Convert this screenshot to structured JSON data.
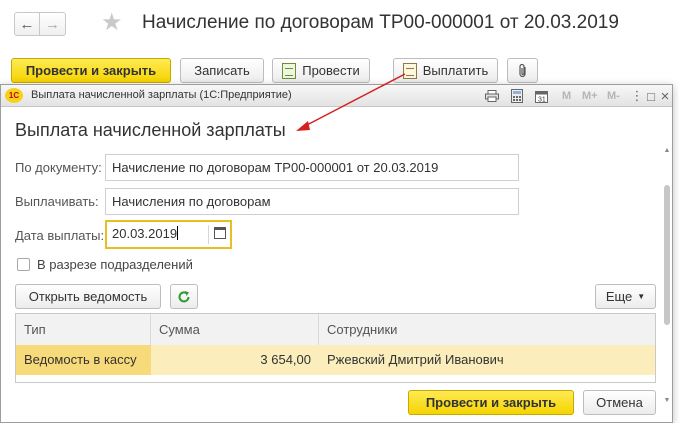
{
  "document": {
    "title": "Начисление по договорам ТР00-000001 от 20.03.2019",
    "nav": {
      "back_icon": "←",
      "forward_icon": "→",
      "favorite_icon": "★"
    },
    "toolbar": {
      "post_and_close_label": "Провести и закрыть",
      "save_label": "Записать",
      "post_label": "Провести",
      "pay_label": "Выплатить",
      "attach_icon": "📎"
    }
  },
  "dialog": {
    "window_title": "Выплата начисленной зарплаты  (1С:Предприятие)",
    "app_logo": "1С",
    "window_controls": {
      "m": "M",
      "m_plus": "M+",
      "m_minus": "M-",
      "more": "⋮",
      "maximize": "□",
      "close": "×"
    },
    "heading": "Выплата начисленной зарплаты",
    "fields": {
      "document_label": "По документу:",
      "document_value": "Начисление по договорам ТР00-000001 от 20.03.2019",
      "pay_out_label": "Выплачивать:",
      "pay_out_value": "Начисления по договорам",
      "date_label": "Дата выплаты:",
      "date_value": "20.03.2019",
      "by_division_label": "В разрезе подразделений",
      "by_division_checked": false
    },
    "buttons": {
      "open_statement": "Открыть ведомость",
      "more": "Еще",
      "post_and_close": "Провести  и закрыть",
      "cancel": "Отмена"
    },
    "table": {
      "columns": [
        "Тип",
        "Сумма",
        "Сотрудники"
      ],
      "rows": [
        {
          "type": "Ведомость в кассу",
          "sum": "3 654,00",
          "employees": "Ржевский Дмитрий Иванович"
        }
      ]
    }
  },
  "colors": {
    "primary_button": "#f5d400",
    "selected_row": "#fbeebc",
    "arrow": "#d42020"
  }
}
